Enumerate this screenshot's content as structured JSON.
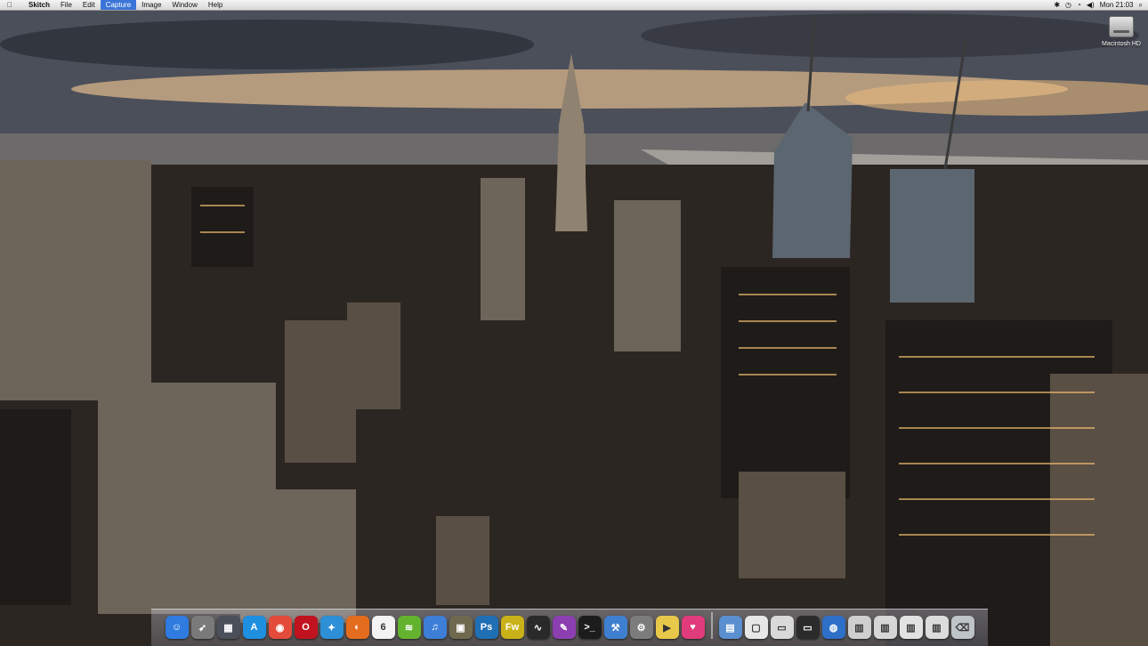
{
  "menubar": {
    "apple_icon": "apple-icon",
    "app_name": "Skitch",
    "items": [
      "File",
      "Edit",
      "Capture",
      "Image",
      "Window",
      "Help"
    ],
    "active_item": "Capture",
    "status_icons": [
      "bluetooth-icon",
      "time-machine-icon",
      "wifi-icon",
      "volume-icon"
    ],
    "clock": "Mon 21:03",
    "spotlight_icon": "spotlight-icon"
  },
  "desktop": {
    "drive_label": "Macintosh HD"
  },
  "dock": {
    "apps": [
      {
        "name": "Finder",
        "icon": "finder-icon",
        "color": "#2f7be0",
        "glyph": "☺"
      },
      {
        "name": "Launchpad",
        "icon": "rocket-icon",
        "color": "#7a7a7a",
        "glyph": "➶"
      },
      {
        "name": "Mission Control",
        "icon": "mission-control-icon",
        "color": "#4a4f5a",
        "glyph": "▦"
      },
      {
        "name": "App Store",
        "icon": "app-store-icon",
        "color": "#1f8fe0",
        "glyph": "A"
      },
      {
        "name": "Chrome",
        "icon": "chrome-icon",
        "color": "#e44b3b",
        "glyph": "◉"
      },
      {
        "name": "Opera",
        "icon": "opera-icon",
        "color": "#c1121f",
        "glyph": "O"
      },
      {
        "name": "Safari",
        "icon": "safari-icon",
        "color": "#2d8fd6",
        "glyph": "✦"
      },
      {
        "name": "Firefox",
        "icon": "firefox-icon",
        "color": "#e46c1e",
        "glyph": "◐"
      },
      {
        "name": "iCal",
        "icon": "calendar-icon",
        "color": "#f3f3f3",
        "glyph": "6"
      },
      {
        "name": "Spotify",
        "icon": "spotify-icon",
        "color": "#63b32e",
        "glyph": "≋"
      },
      {
        "name": "iTunes",
        "icon": "itunes-icon",
        "color": "#3d7ed6",
        "glyph": "♫"
      },
      {
        "name": "iPhoto",
        "icon": "iphoto-icon",
        "color": "#6f6a4f",
        "glyph": "▣"
      },
      {
        "name": "Photoshop",
        "icon": "photoshop-icon",
        "color": "#1f6fb4",
        "glyph": "Ps"
      },
      {
        "name": "Fireworks",
        "icon": "fireworks-icon",
        "color": "#c9b217",
        "glyph": "Fw"
      },
      {
        "name": "Activity Monitor",
        "icon": "activity-monitor-icon",
        "color": "#2a2a2a",
        "glyph": "∿"
      },
      {
        "name": "Pages",
        "icon": "pages-icon",
        "color": "#8b3fb0",
        "glyph": "✎"
      },
      {
        "name": "Terminal",
        "icon": "terminal-icon",
        "color": "#1c1c1c",
        "glyph": ">_"
      },
      {
        "name": "Xcode",
        "icon": "xcode-icon",
        "color": "#3f7fd0",
        "glyph": "⚒"
      },
      {
        "name": "System Preferences",
        "icon": "gear-icon",
        "color": "#7c7c7c",
        "glyph": "⚙"
      },
      {
        "name": "Transmit",
        "icon": "truck-icon",
        "color": "#e8c84a",
        "glyph": "▶"
      },
      {
        "name": "Heart",
        "icon": "heart-icon",
        "color": "#e03b7a",
        "glyph": "♥"
      }
    ],
    "stacks": [
      {
        "name": "Applications",
        "icon": "applications-stack-icon",
        "color": "#5a8fd0",
        "glyph": "▤"
      },
      {
        "name": "Documents",
        "icon": "documents-stack-icon",
        "color": "#e7e7e7",
        "glyph": "▢"
      },
      {
        "name": "Screenshot",
        "icon": "screenshot-stack-icon",
        "color": "#d9d9d9",
        "glyph": "▭"
      },
      {
        "name": "Screenshot 2",
        "icon": "screenshot-stack-icon",
        "color": "#2b2b2b",
        "glyph": "▭"
      },
      {
        "name": "Downloads",
        "icon": "globe-icon",
        "color": "#2e6fc8",
        "glyph": "◍"
      },
      {
        "name": "Files",
        "icon": "files-stack-icon",
        "color": "#cfcfcf",
        "glyph": "▥"
      },
      {
        "name": "Files 2",
        "icon": "files-stack-icon",
        "color": "#d6d6d6",
        "glyph": "▥"
      },
      {
        "name": "Files 3",
        "icon": "files-stack-icon",
        "color": "#e2e2e2",
        "glyph": "▥"
      },
      {
        "name": "Files 4",
        "icon": "files-stack-icon",
        "color": "#dcdcdc",
        "glyph": "▥"
      },
      {
        "name": "Trash",
        "icon": "trash-icon",
        "color": "#bfc4c9",
        "glyph": "⌫"
      }
    ]
  }
}
